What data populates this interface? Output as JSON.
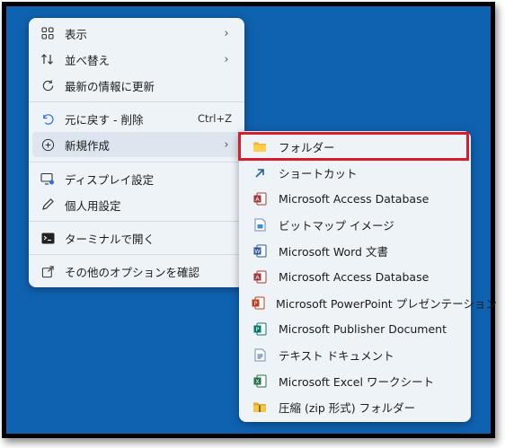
{
  "context_menu": {
    "items": [
      {
        "label": "表示",
        "icon": "grid-icon",
        "has_submenu": true
      },
      {
        "label": "並べ替え",
        "icon": "sort-icon",
        "has_submenu": true
      },
      {
        "label": "最新の情報に更新",
        "icon": "refresh-icon"
      },
      {
        "label": "元に戻す - 削除",
        "icon": "undo-icon",
        "shortcut": "Ctrl+Z"
      },
      {
        "label": "新規作成",
        "icon": "new-plus-icon",
        "has_submenu": true
      },
      {
        "label": "ディスプレイ設定",
        "icon": "display-settings-icon"
      },
      {
        "label": "個人用設定",
        "icon": "pen-icon"
      },
      {
        "label": "ターミナルで開く",
        "icon": "terminal-icon"
      },
      {
        "label": "その他のオプションを確認",
        "icon": "share-icon"
      }
    ]
  },
  "submenu": {
    "items": [
      {
        "label": "フォルダー",
        "icon": "folder-icon"
      },
      {
        "label": "ショートカット",
        "icon": "shortcut-arrow-icon"
      },
      {
        "label": "Microsoft Access Database",
        "icon": "access-icon"
      },
      {
        "label": "ビットマップ イメージ",
        "icon": "bitmap-icon"
      },
      {
        "label": "Microsoft Word 文書",
        "icon": "word-icon"
      },
      {
        "label": "Microsoft Access Database",
        "icon": "access-icon"
      },
      {
        "label": "Microsoft PowerPoint プレゼンテーション",
        "icon": "powerpoint-icon"
      },
      {
        "label": "Microsoft Publisher Document",
        "icon": "publisher-icon"
      },
      {
        "label": "テキスト ドキュメント",
        "icon": "text-document-icon"
      },
      {
        "label": "Microsoft Excel ワークシート",
        "icon": "excel-icon"
      },
      {
        "label": "圧縮 (zip 形式) フォルダー",
        "icon": "zip-folder-icon"
      }
    ]
  },
  "colors": {
    "desktop": "#0f62b0",
    "highlight_border": "#d81e2a",
    "menu_bg": "#eef3f8"
  }
}
